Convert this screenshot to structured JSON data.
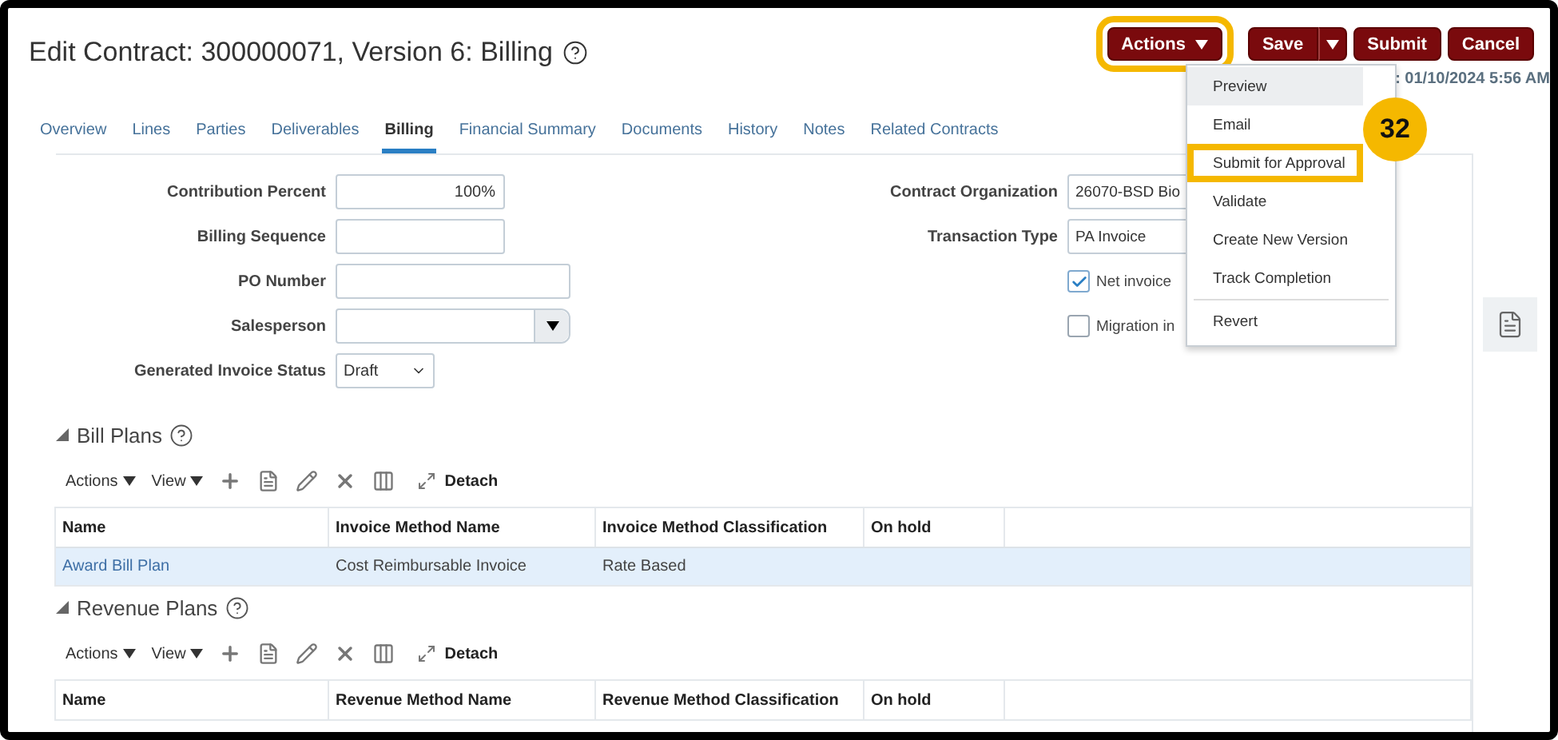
{
  "title": "Edit Contract: 300000071, Version 6: Billing",
  "header_buttons": [
    {
      "label": "Actions",
      "kind": "menu",
      "highlighted": true
    },
    {
      "label": "Save",
      "kind": "split"
    },
    {
      "label": "Submit",
      "kind": "plain"
    },
    {
      "label": "Cancel",
      "kind": "plain"
    }
  ],
  "last_saved": ": 01/10/2024 5:56 AM",
  "tabs": [
    {
      "label": "Overview",
      "selected": false
    },
    {
      "label": "Lines",
      "selected": false
    },
    {
      "label": "Parties",
      "selected": false
    },
    {
      "label": "Deliverables",
      "selected": false
    },
    {
      "label": "Billing",
      "selected": true
    },
    {
      "label": "Financial Summary",
      "selected": false
    },
    {
      "label": "Documents",
      "selected": false
    },
    {
      "label": "History",
      "selected": false
    },
    {
      "label": "Notes",
      "selected": false
    },
    {
      "label": "Related Contracts",
      "selected": false
    }
  ],
  "left_fields": [
    {
      "label": "Contribution Percent",
      "kind": "number",
      "value": "100%"
    },
    {
      "label": "Billing Sequence",
      "kind": "number"
    },
    {
      "label": "PO Number",
      "kind": "text"
    },
    {
      "label": "Salesperson",
      "kind": "combo"
    },
    {
      "label": "Generated Invoice Status",
      "kind": "select",
      "value": "Draft"
    }
  ],
  "right_fields": [
    {
      "label": "Contract Organization",
      "value": "26070-BSD Bio"
    },
    {
      "label": "Transaction Type",
      "value": "PA Invoice"
    }
  ],
  "checkboxes": [
    {
      "label": "Net invoice",
      "checked": true
    },
    {
      "label": "Migration in",
      "checked": false
    }
  ],
  "sections": [
    {
      "title": "Bill Plans",
      "toolbar": {
        "actions": "Actions",
        "view": "View",
        "detach": "Detach"
      },
      "columns": [
        "Name",
        "Invoice Method Name",
        "Invoice Method Classification",
        "On hold"
      ],
      "rows": [
        {
          "cells": [
            "Award Bill Plan",
            "Cost Reimbursable Invoice",
            "Rate Based"
          ],
          "selected": true
        }
      ]
    },
    {
      "title": "Revenue Plans",
      "toolbar": {
        "actions": "Actions",
        "view": "View",
        "detach": "Detach"
      },
      "columns": [
        "Name",
        "Revenue Method Name",
        "Revenue Method Classification",
        "On hold"
      ]
    }
  ],
  "menu": {
    "items": [
      {
        "label": "Preview",
        "selected": true,
        "highlighted": false
      },
      {
        "label": "Email",
        "selected": false,
        "highlighted": false
      },
      {
        "label": "Submit for Approval",
        "selected": false,
        "highlighted": true
      },
      {
        "label": "Validate",
        "selected": false,
        "highlighted": false
      },
      {
        "label": "Create New Version",
        "selected": false,
        "highlighted": false
      },
      {
        "label": "Track Completion",
        "selected": false,
        "highlighted": false
      },
      {
        "label": "Revert",
        "selected": false,
        "highlighted": false,
        "divider_before": true
      }
    ]
  },
  "step_badge": "32"
}
